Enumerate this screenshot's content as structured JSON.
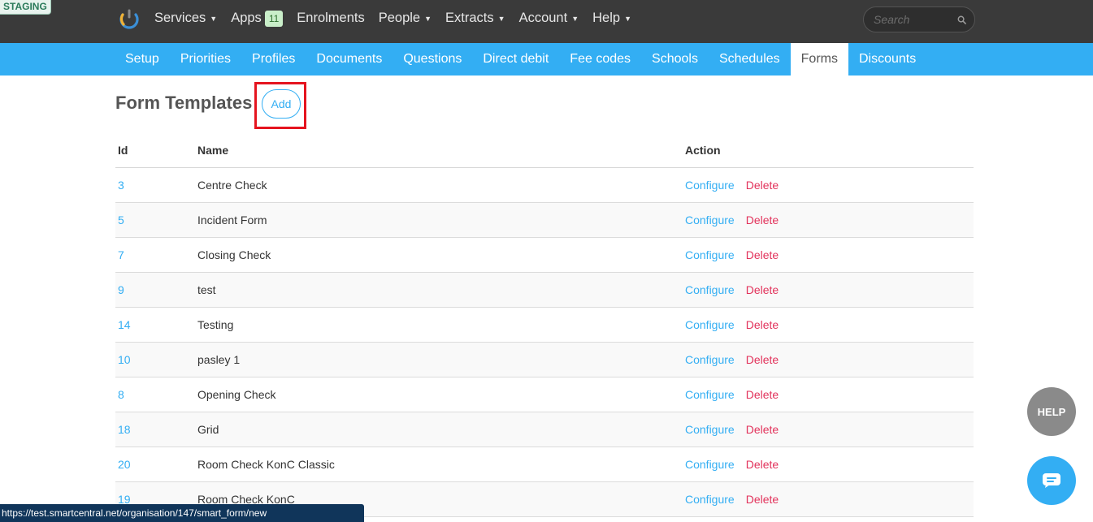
{
  "env_badge": "STAGING",
  "topnav": {
    "items": [
      {
        "label": "Services",
        "caret": true
      },
      {
        "label": "Apps",
        "badge": "11"
      },
      {
        "label": "Enrolments"
      },
      {
        "label": "People",
        "caret": true
      },
      {
        "label": "Extracts",
        "caret": true
      },
      {
        "label": "Account",
        "caret": true
      },
      {
        "label": "Help",
        "caret": true
      }
    ],
    "search_placeholder": "Search"
  },
  "subnav": {
    "items": [
      "Setup",
      "Priorities",
      "Profiles",
      "Documents",
      "Questions",
      "Direct debit",
      "Fee codes",
      "Schools",
      "Schedules",
      "Forms",
      "Discounts"
    ],
    "active": "Forms"
  },
  "page": {
    "title": "Form Templates",
    "add_label": "Add"
  },
  "table": {
    "headers": {
      "id": "Id",
      "name": "Name",
      "action": "Action"
    },
    "configure_label": "Configure",
    "delete_label": "Delete",
    "rows": [
      {
        "id": "3",
        "name": "Centre Check"
      },
      {
        "id": "5",
        "name": "Incident Form"
      },
      {
        "id": "7",
        "name": "Closing Check"
      },
      {
        "id": "9",
        "name": "test"
      },
      {
        "id": "14",
        "name": "Testing"
      },
      {
        "id": "10",
        "name": "pasley 1"
      },
      {
        "id": "8",
        "name": "Opening Check"
      },
      {
        "id": "18",
        "name": "Grid"
      },
      {
        "id": "20",
        "name": "Room Check KonC Classic"
      },
      {
        "id": "19",
        "name": "Room Check KonC"
      }
    ]
  },
  "help_fab": "HELP",
  "status_url": "https://test.smartcentral.net/organisation/147/smart_form/new",
  "colors": {
    "accent": "#33aef3",
    "topbar": "#3a3a3a",
    "delete": "#e2325b",
    "highlight": "#e5141f"
  }
}
